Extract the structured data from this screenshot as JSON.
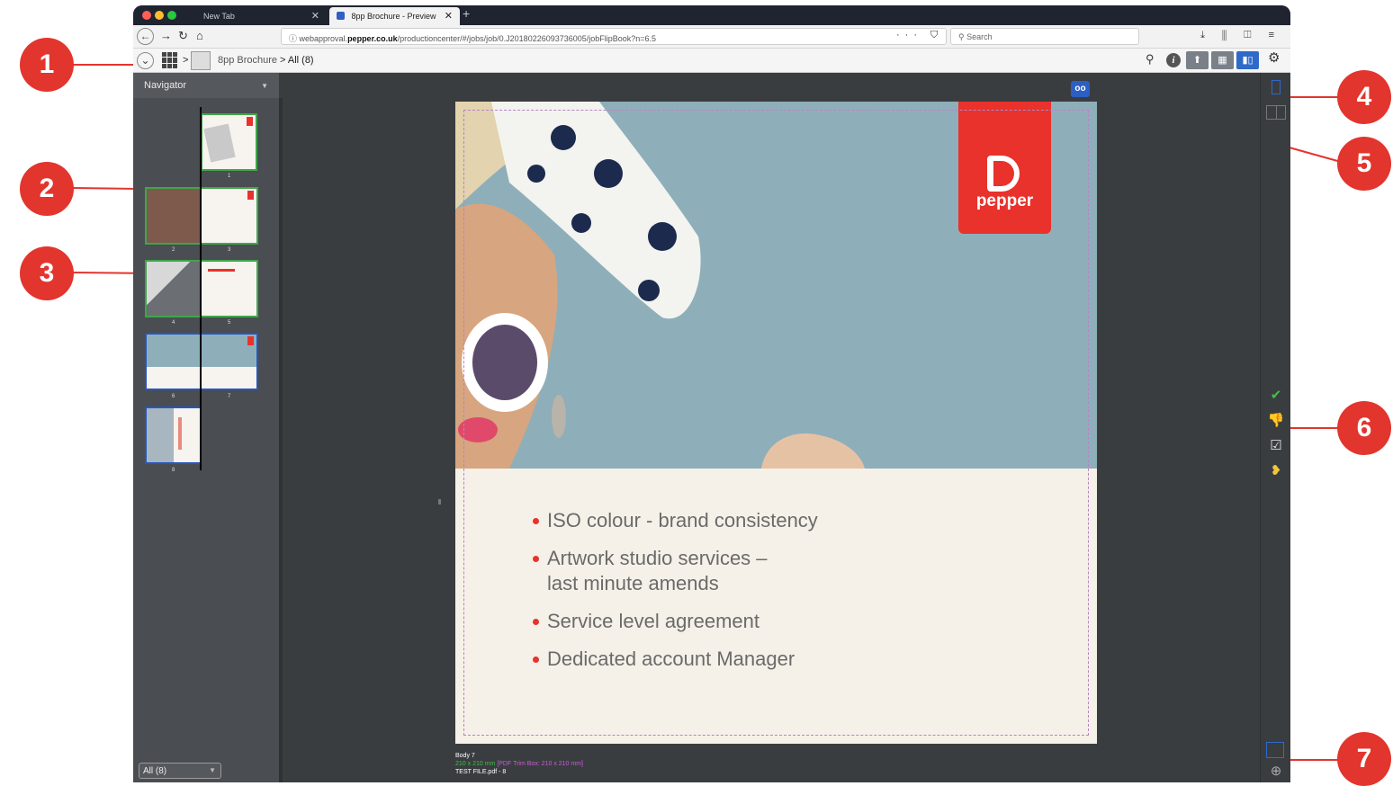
{
  "browser": {
    "tabs": [
      {
        "label": "New Tab",
        "close": "✕"
      },
      {
        "label": "8pp Brochure - Preview",
        "close": "✕"
      }
    ],
    "new_tab": "+",
    "url_prefix": "webapproval.",
    "url_domain": "pepper.co.uk",
    "url_path": "/productioncenter/#/jobs/job/0.J20180226093736005/jobFlipBook?n=6.5",
    "url_actions": "··· ⛉ ☆",
    "search_placeholder": "Search",
    "toolbar_icons": "⤓ ⫼ ◫ ≡"
  },
  "app": {
    "breadcrumb_sep": ">",
    "job_name": "8pp Brochure",
    "section": "> All (8)"
  },
  "navigator": {
    "title": "Navigator",
    "filter_value": "All (8)",
    "page_numbers": [
      "1",
      "2",
      "3",
      "4",
      "5",
      "6",
      "7",
      "8"
    ]
  },
  "document": {
    "logo_text": "pepper",
    "bullets": [
      "ISO colour - brand consistency",
      "Artwork studio services –\nlast minute amends",
      "Service level agreement",
      "Dedicated account Manager"
    ],
    "caption_name": "Body 7",
    "caption_size": "210 x 210 mm",
    "caption_trim": "[PDF Trim Box: 210 x 210 mm]",
    "caption_file": "TEST FILE.pdf - 8"
  },
  "rail": {
    "approve_icon": "✔",
    "reject_icon": "👎",
    "approve_forward_icon": "☑",
    "banana_icon": "❥",
    "zoom_icon": "⊕"
  },
  "callouts": [
    "1",
    "2",
    "3",
    "4",
    "5",
    "6",
    "7"
  ],
  "colors": {
    "accent": "#e2352d",
    "select_blue": "#2f6ac9",
    "approved_green": "#3fa64a"
  }
}
